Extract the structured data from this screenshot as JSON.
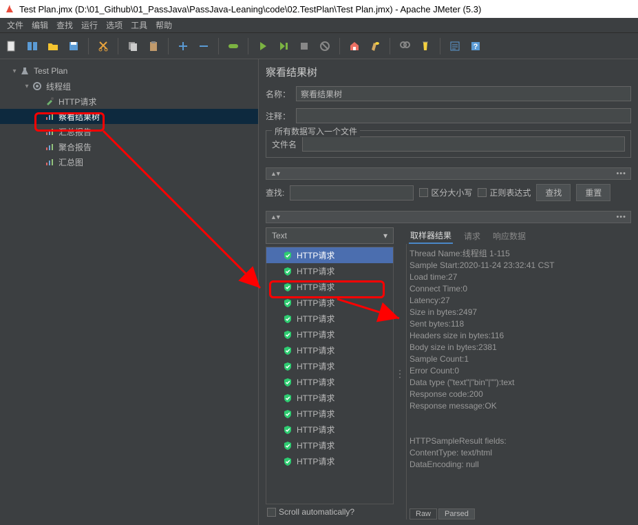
{
  "titlebar": {
    "text": "Test Plan.jmx (D:\\01_Github\\01_PassJava\\PassJava-Leaning\\code\\02.TestPlan\\Test Plan.jmx) - Apache JMeter (5.3)"
  },
  "menu": {
    "file": "文件",
    "edit": "编辑",
    "search": "查找",
    "run": "运行",
    "options": "选项",
    "tools": "工具",
    "help": "帮助"
  },
  "tree": {
    "root": "Test Plan",
    "thread_group": "线程组",
    "http_request": "HTTP请求",
    "view_results_tree": "察看结果树",
    "summary_report": "汇总报告",
    "aggregate_report": "聚合报告",
    "summary_graph": "汇总图"
  },
  "panel": {
    "title": "察看结果树",
    "name_label": "名称：",
    "name_value": "察看结果树",
    "comment_label": "注释：",
    "file_fieldset": "所有数据写入一个文件",
    "filename_label": "文件名"
  },
  "search": {
    "label": "查找:",
    "case_sensitive": "区分大小写",
    "regex": "正则表达式",
    "find_btn": "查找",
    "reset_btn": "重置"
  },
  "dropdown": {
    "value": "Text"
  },
  "result_item_label": "HTTP请求",
  "tabs": {
    "sampler": "取样器结果",
    "request": "请求",
    "response": "响应数据"
  },
  "details": [
    "Thread Name:线程组 1-115",
    "Sample Start:2020-11-24 23:32:41 CST",
    "Load time:27",
    "Connect Time:0",
    "Latency:27",
    "Size in bytes:2497",
    "Sent bytes:118",
    "Headers size in bytes:116",
    "Body size in bytes:2381",
    "Sample Count:1",
    "Error Count:0",
    "Data type (\"text\"|\"bin\"|\"\"):text",
    "Response code:200",
    "Response message:OK",
    "",
    "",
    "HTTPSampleResult fields:",
    "ContentType: text/html",
    "DataEncoding: null"
  ],
  "raw": "Raw",
  "parsed": "Parsed",
  "scroll_auto": "Scroll automatically?"
}
